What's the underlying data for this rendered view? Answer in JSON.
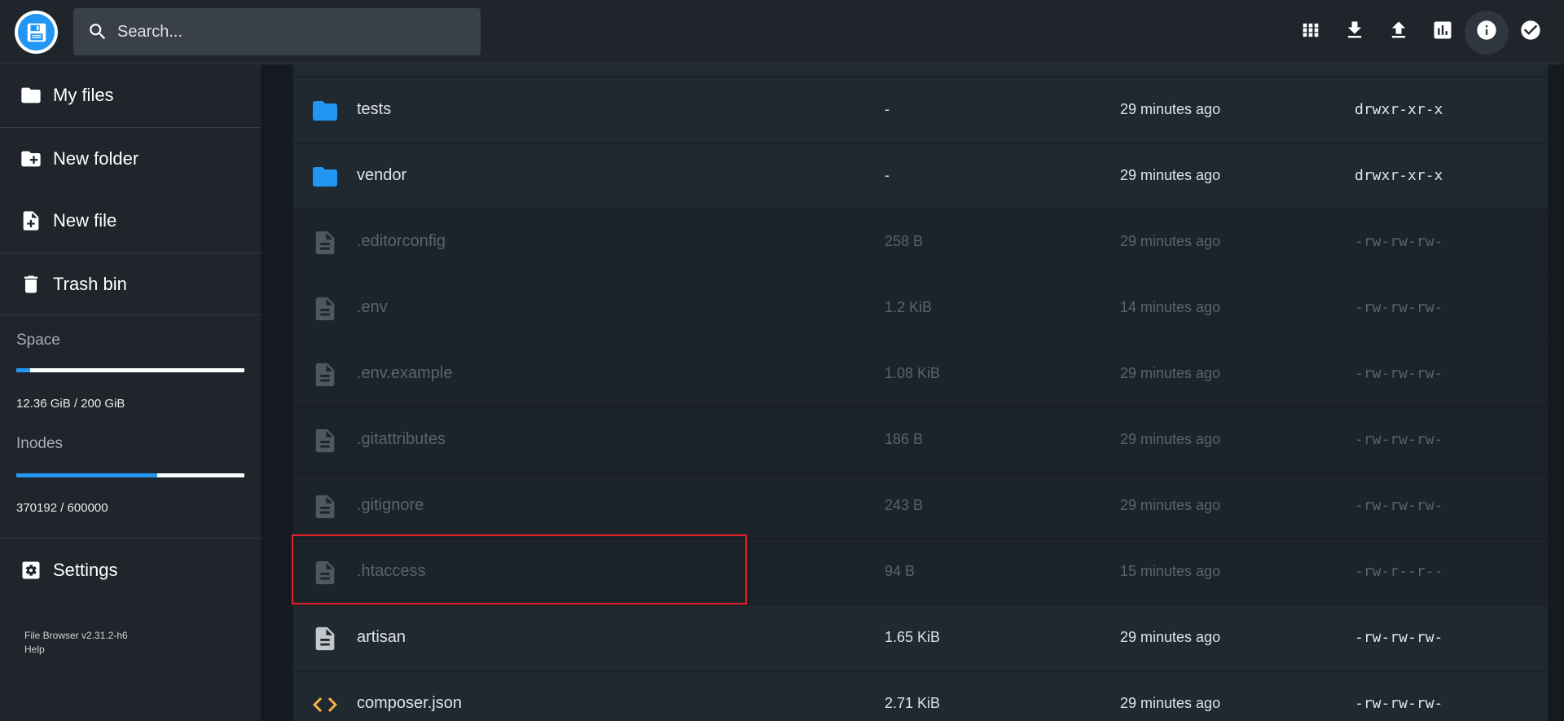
{
  "header": {
    "search_placeholder": "Search...",
    "toolbar": [
      {
        "name": "grid-view-icon"
      },
      {
        "name": "download-icon"
      },
      {
        "name": "upload-icon"
      },
      {
        "name": "stats-icon"
      },
      {
        "name": "info-icon"
      },
      {
        "name": "select-check-icon"
      }
    ]
  },
  "sidebar": {
    "items": {
      "my_files": "My files",
      "new_folder": "New folder",
      "new_file": "New file",
      "trash_bin": "Trash bin",
      "settings": "Settings"
    },
    "space": {
      "title": "Space",
      "text": "12.36 GiB / 200 GiB",
      "fraction": 0.0618
    },
    "inodes": {
      "title": "Inodes",
      "text": "370192 / 600000",
      "fraction": 0.617
    },
    "footer": {
      "version": "File Browser v2.31.2-h6",
      "help": "Help"
    }
  },
  "files": [
    {
      "name": "tests",
      "size": "-",
      "modified": "29 minutes ago",
      "perm": "drwxr-xr-x",
      "type": "folder",
      "dim": false
    },
    {
      "name": "vendor",
      "size": "-",
      "modified": "29 minutes ago",
      "perm": "drwxr-xr-x",
      "type": "folder",
      "dim": false
    },
    {
      "name": ".editorconfig",
      "size": "258 B",
      "modified": "29 minutes ago",
      "perm": "-rw-rw-rw-",
      "type": "file",
      "dim": true
    },
    {
      "name": ".env",
      "size": "1.2 KiB",
      "modified": "14 minutes ago",
      "perm": "-rw-rw-rw-",
      "type": "file",
      "dim": true
    },
    {
      "name": ".env.example",
      "size": "1.08 KiB",
      "modified": "29 minutes ago",
      "perm": "-rw-rw-rw-",
      "type": "file",
      "dim": true
    },
    {
      "name": ".gitattributes",
      "size": "186 B",
      "modified": "29 minutes ago",
      "perm": "-rw-rw-rw-",
      "type": "file",
      "dim": true
    },
    {
      "name": ".gitignore",
      "size": "243 B",
      "modified": "29 minutes ago",
      "perm": "-rw-rw-rw-",
      "type": "file",
      "dim": true
    },
    {
      "name": ".htaccess",
      "size": "94 B",
      "modified": "15 minutes ago",
      "perm": "-rw-r--r--",
      "type": "file",
      "dim": true
    },
    {
      "name": "artisan",
      "size": "1.65 KiB",
      "modified": "29 minutes ago",
      "perm": "-rw-rw-rw-",
      "type": "file",
      "dim": false
    },
    {
      "name": "composer.json",
      "size": "2.71 KiB",
      "modified": "29 minutes ago",
      "perm": "-rw-rw-rw-",
      "type": "code",
      "dim": false
    }
  ],
  "colors": {
    "accent": "#2196f3",
    "folder": "#2196f3",
    "code": "#f5b041",
    "highlight": "#e3202e"
  }
}
